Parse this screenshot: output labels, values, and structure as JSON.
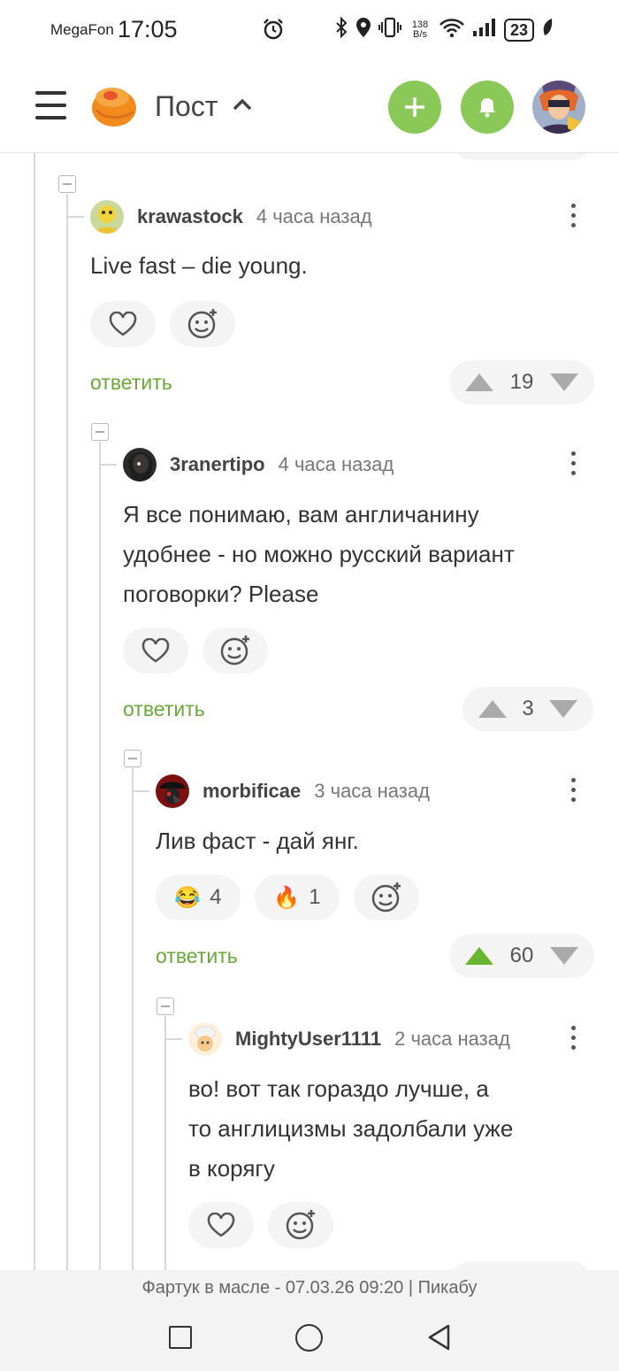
{
  "status_bar": {
    "carrier": "MegaFon",
    "time": "17:05",
    "net_speed_value": "138",
    "net_speed_unit": "B/s",
    "battery": "23"
  },
  "header": {
    "title": "Пост"
  },
  "comments": [
    {
      "user": "krawastock",
      "time": "4 часа назад",
      "text": "Live fast – die young.",
      "reply_label": "ответить",
      "rating": "19",
      "upvoted": false
    },
    {
      "user": "3ranertipo",
      "time": "4 часа назад",
      "text_lines": [
        "Я все понимаю, вам англичанину",
        "удобнее - но можно русский вариант",
        "поговорки? Please"
      ],
      "reply_label": "ответить",
      "rating": "3",
      "upvoted": false
    },
    {
      "user": "morbificae",
      "time": "3 часа назад",
      "text": "Лив фаст - дай янг.",
      "reactions": [
        {
          "emoji": "😂",
          "count": "4"
        },
        {
          "emoji": "🔥",
          "count": "1"
        }
      ],
      "reply_label": "ответить",
      "rating": "60",
      "upvoted": true
    },
    {
      "user": "MightyUser1111",
      "time": "2 часа назад",
      "text_lines": [
        "во! вот так гораздо лучше, а",
        "то англицизмы задолбали уже",
        "в корягу"
      ]
    }
  ],
  "footer": {
    "caption": "Фартук в масле - 07.03.26 09:20 | Пикабу"
  },
  "colors": {
    "accent_green": "#8ac858",
    "reply_green": "#6aa838",
    "upvote_active": "#6ab42f"
  }
}
